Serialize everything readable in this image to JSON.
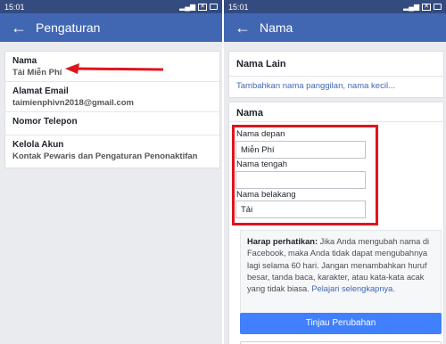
{
  "left": {
    "status_time": "15:01",
    "title": "Pengaturan",
    "rows": [
      {
        "title": "Nama",
        "sub": "Tải Miễn Phí"
      },
      {
        "title": "Alamat Email",
        "sub": "taimienphivn2018@gmail.com"
      },
      {
        "title": "Nomor Telepon",
        "sub": ""
      },
      {
        "title": "Kelola Akun",
        "sub": "Kontak Pewaris dan Pengaturan Penonaktifan"
      }
    ]
  },
  "right": {
    "status_time": "15:01",
    "title": "Nama",
    "nama_lain": {
      "heading": "Nama Lain",
      "link": "Tambahkan nama panggilan, nama kecil..."
    },
    "nama": {
      "heading": "Nama",
      "first_label": "Nama depan",
      "first_value": "Miễn Phí",
      "middle_label": "Nama tengah",
      "middle_value": "",
      "last_label": "Nama belakang",
      "last_value": "Tải"
    },
    "notice": {
      "bold": "Harap perhatikan:",
      "text": " Jika Anda mengubah nama di Facebook, maka Anda tidak dapat mengubahnya lagi selama 60 hari. Jangan menambahkan huruf besar, tanda baca, karakter, atau kata-kata acak yang tidak biasa. ",
      "link": "Pelajari selengkapnya."
    },
    "review_button": "Tinjau Perubahan"
  },
  "colors": {
    "appbar": "#4267b2",
    "statusbar": "#344b80",
    "button": "#4080ff",
    "highlight": "#e0141b"
  }
}
